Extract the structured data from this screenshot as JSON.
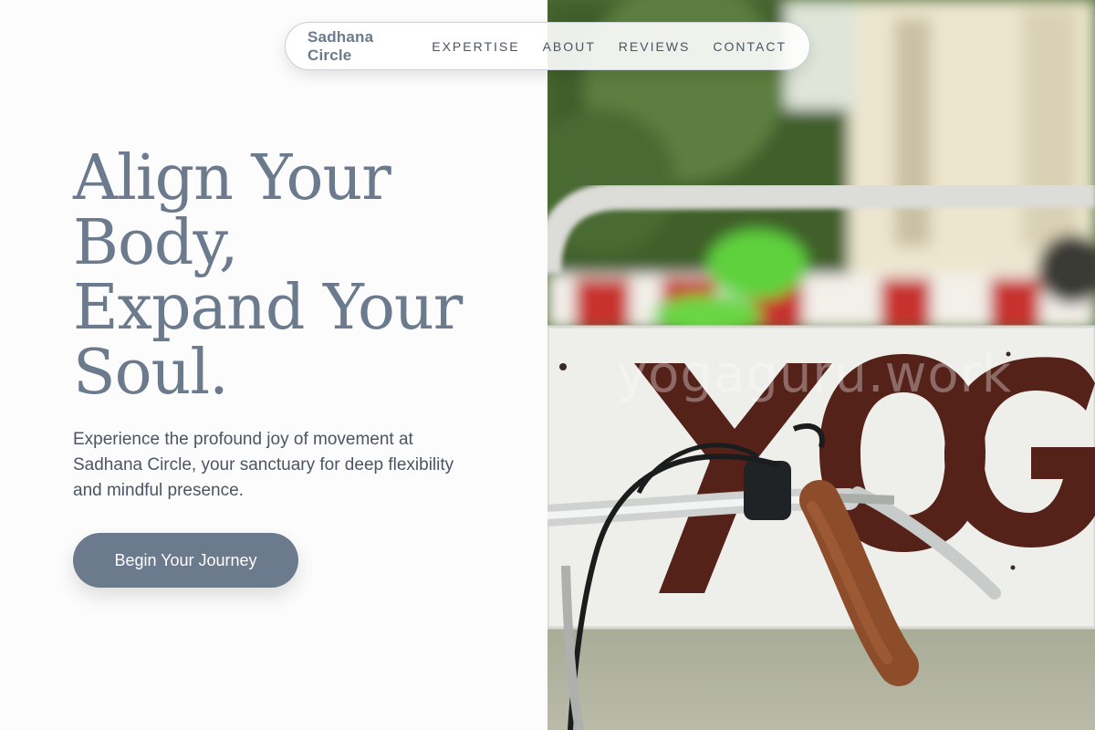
{
  "nav": {
    "brand": "Sadhana Circle",
    "links": [
      "EXPERTISE",
      "ABOUT",
      "REVIEWS",
      "CONTACT"
    ]
  },
  "hero": {
    "title_lines": [
      "Align Your",
      "Body,",
      "Expand Your",
      "Soul."
    ],
    "subtitle": "Experience the profound joy of movement at Sadhana Circle, your sanctuary for deep flexibility and mindful presence.",
    "cta_label": "Begin Your Journey"
  },
  "image": {
    "description": "Bicycle parked in front of a sign reading YOGA",
    "sign_text": "YOGA",
    "watermark": "yogaguru.work"
  },
  "colors": {
    "accent": "#6b7a8d",
    "text": "#4b5563",
    "background": "#fcfcfc"
  }
}
